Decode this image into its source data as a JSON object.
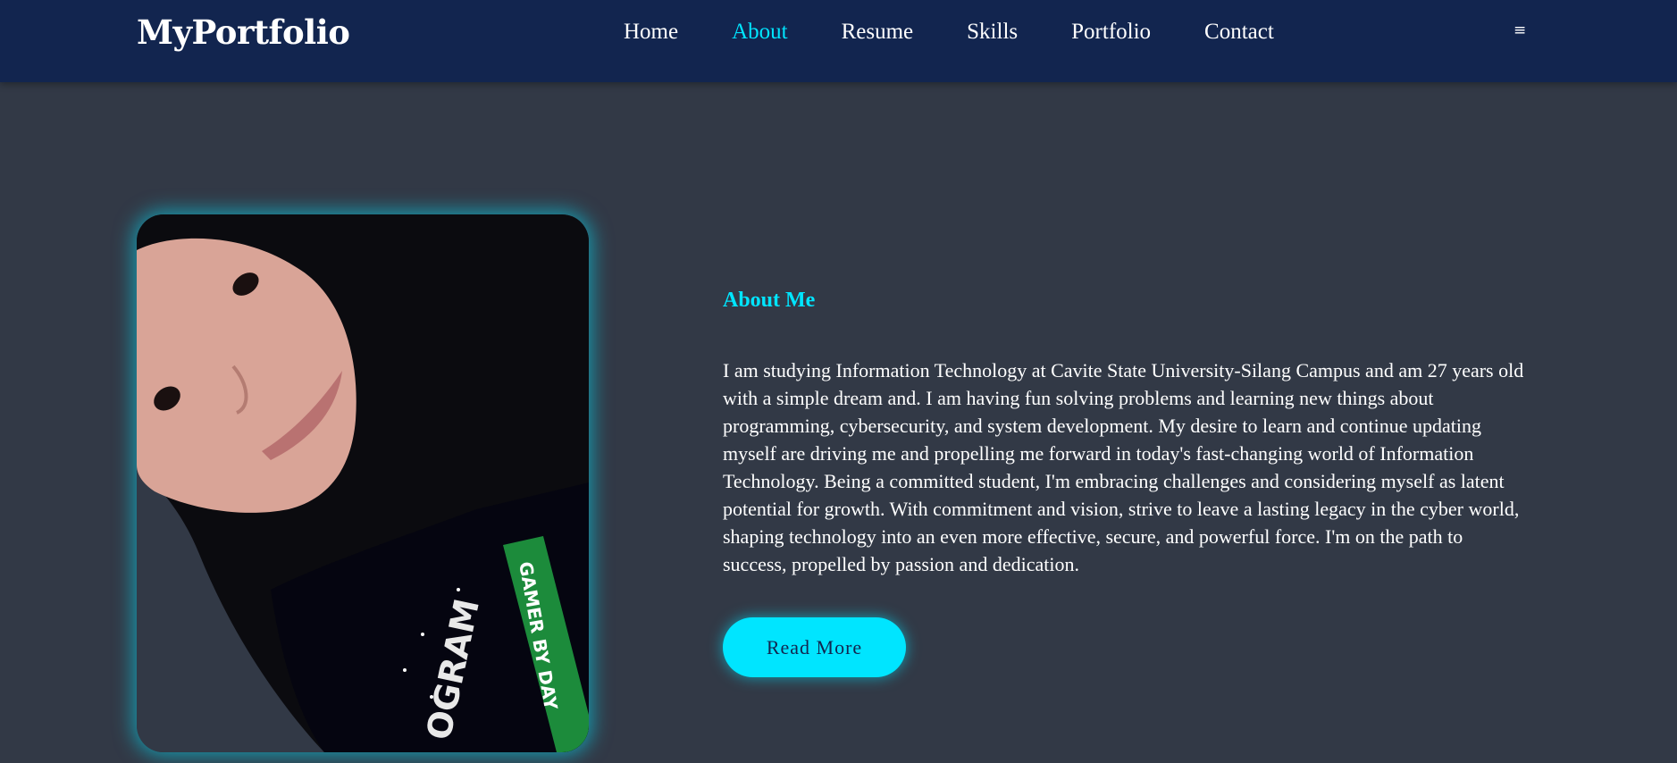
{
  "header": {
    "logo": "MyPortfolio",
    "nav": [
      "Home",
      "About",
      "Resume",
      "Skills",
      "Portfolio",
      "Contact"
    ],
    "active_item": "About",
    "menu_icon": "≡"
  },
  "about": {
    "title": "About Me",
    "paragraph": "I am studying Information Technology at Cavite State University-Silang Campus and am 27 years old with a simple dream and. I am having fun solving problems and learning new things about programming, cybersecurity, and system development. My desire to learn and continue updating myself are driving me and propelling me forward in today's fast-changing world of Information Technology. Being a committed student, I'm embracing challenges and considering myself as latent potential for growth. With commitment and vision, strive to leave a lasting legacy in the cyber world, shaping technology into an even more effective, secure, and powerful force. I'm on the path to success, propelled by passion and dedication.",
    "button": "Read More",
    "lanyard_text": "GAMER BY DAY"
  },
  "colors": {
    "navbar": "#12254f",
    "background": "#323946",
    "accent": "#00e5ff",
    "text": "#ffffff"
  },
  "icons": {
    "menu": "hamburger-menu-icon"
  }
}
